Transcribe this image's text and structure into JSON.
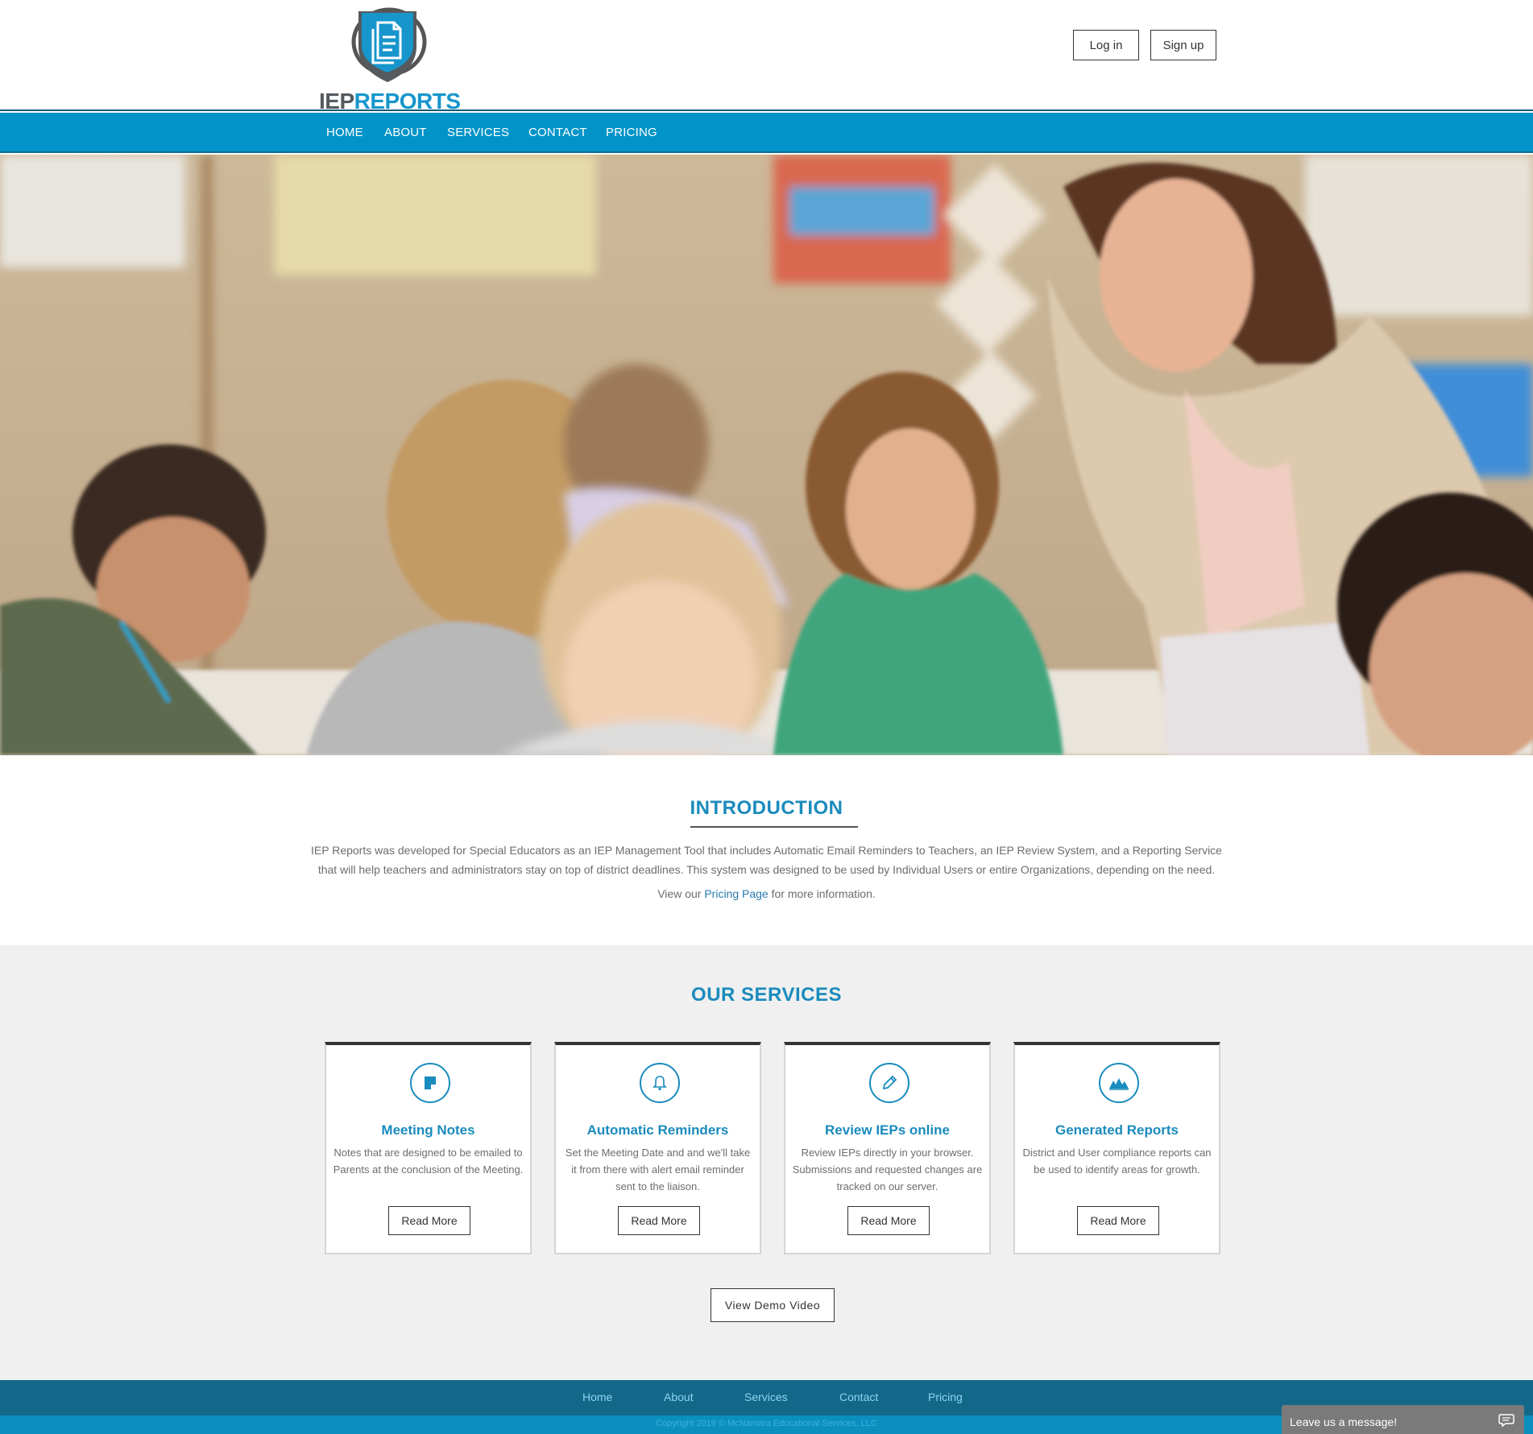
{
  "header": {
    "logo_part1": "IEP",
    "logo_part2": "REPORTS",
    "login_label": "Log in",
    "signup_label": "Sign up"
  },
  "nav": {
    "items": [
      "HOME",
      "ABOUT",
      "SERVICES",
      "CONTACT",
      "PRICING"
    ]
  },
  "intro": {
    "title": "INTRODUCTION",
    "body": "IEP Reports was developed for Special Educators as an IEP Management Tool that includes Automatic Email Reminders to Teachers, an IEP Review System, and a Reporting Service that will help teachers and administrators stay on top of district deadlines. This system was designed to be used by Individual Users or entire Organizations, depending on the need.",
    "pricing_prefix": "View our",
    "pricing_link": "Pricing Page",
    "pricing_suffix": "for more information."
  },
  "services": {
    "title": "OUR SERVICES",
    "cards": [
      {
        "icon": "note-icon",
        "title": "Meeting Notes",
        "text": "Notes that are designed to be emailed to Parents at the conclusion of the Meeting.",
        "button": "Read More"
      },
      {
        "icon": "bell-icon",
        "title": "Automatic Reminders",
        "text": "Set the Meeting Date and and we'll take it from there with alert email reminder sent to the liaison.",
        "button": "Read More"
      },
      {
        "icon": "pencil-icon",
        "title": "Review IEPs online",
        "text": "Review IEPs directly in your browser. Submissions and requested changes are tracked on our server.",
        "button": "Read More"
      },
      {
        "icon": "chart-icon",
        "title": "Generated Reports",
        "text": "District and User compliance reports can be used to identify areas for growth.",
        "button": "Read More"
      }
    ],
    "demo_button": "View Demo Video"
  },
  "footer": {
    "links": [
      "Home",
      "About",
      "Services",
      "Contact",
      "Pricing"
    ],
    "copyright": "Copyright 2019 © McNamara Educational Services, LLC"
  },
  "chat": {
    "label": "Leave us a message!",
    "icon": "chat-bubble-icon"
  },
  "colors": {
    "brand_blue": "#0294c8",
    "heading_blue": "#1a8bbd",
    "footer_dark": "#13688a"
  }
}
